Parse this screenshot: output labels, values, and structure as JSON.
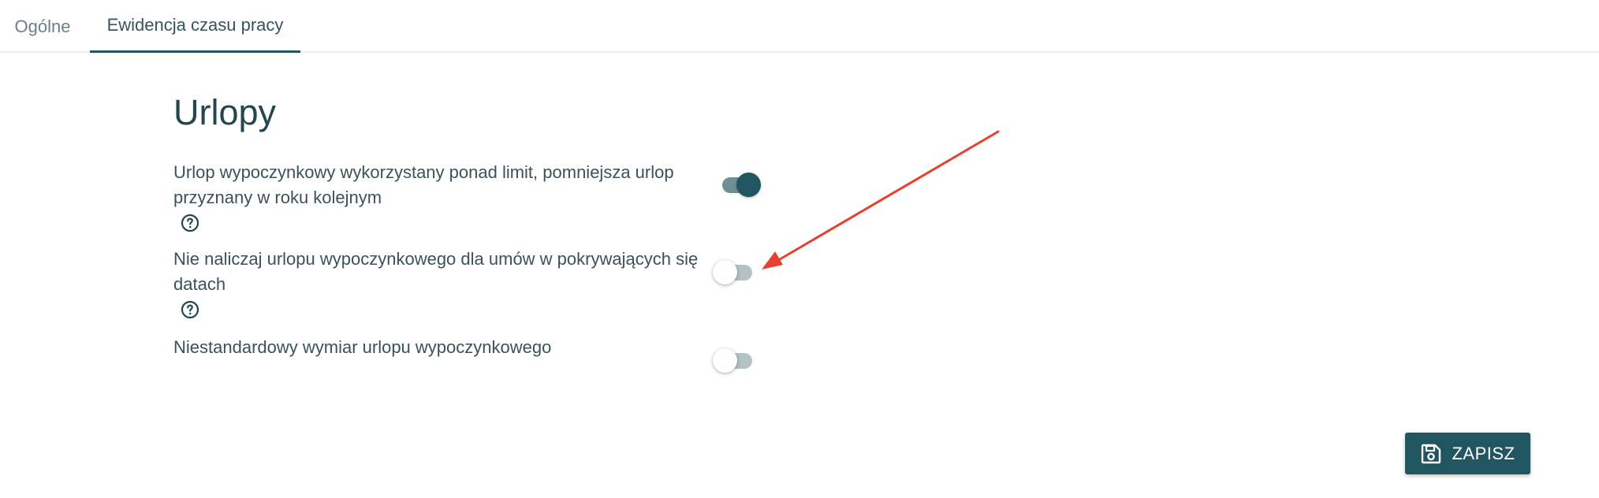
{
  "tabs": [
    {
      "label": "Ogólne",
      "active": false
    },
    {
      "label": "Ewidencja czasu pracy",
      "active": true
    }
  ],
  "section": {
    "title": "Urlopy"
  },
  "settings": [
    {
      "label": "Urlop wypoczynkowy wykorzystany ponad limit, pomniejsza urlop przyznany w roku kolejnym",
      "enabled": true,
      "has_help": true
    },
    {
      "label": "Nie naliczaj urlopu wypoczynkowego dla umów w pokrywających się datach",
      "enabled": false,
      "has_help": true
    },
    {
      "label": "Niestandardowy wymiar urlopu wypoczynkowego",
      "enabled": false,
      "has_help": false
    }
  ],
  "save_button": {
    "label": "ZAPISZ",
    "icon": "floppy-disk-icon"
  },
  "colors": {
    "primary": "#215661",
    "text": "#3a525a",
    "annotation": "#e8402f"
  }
}
